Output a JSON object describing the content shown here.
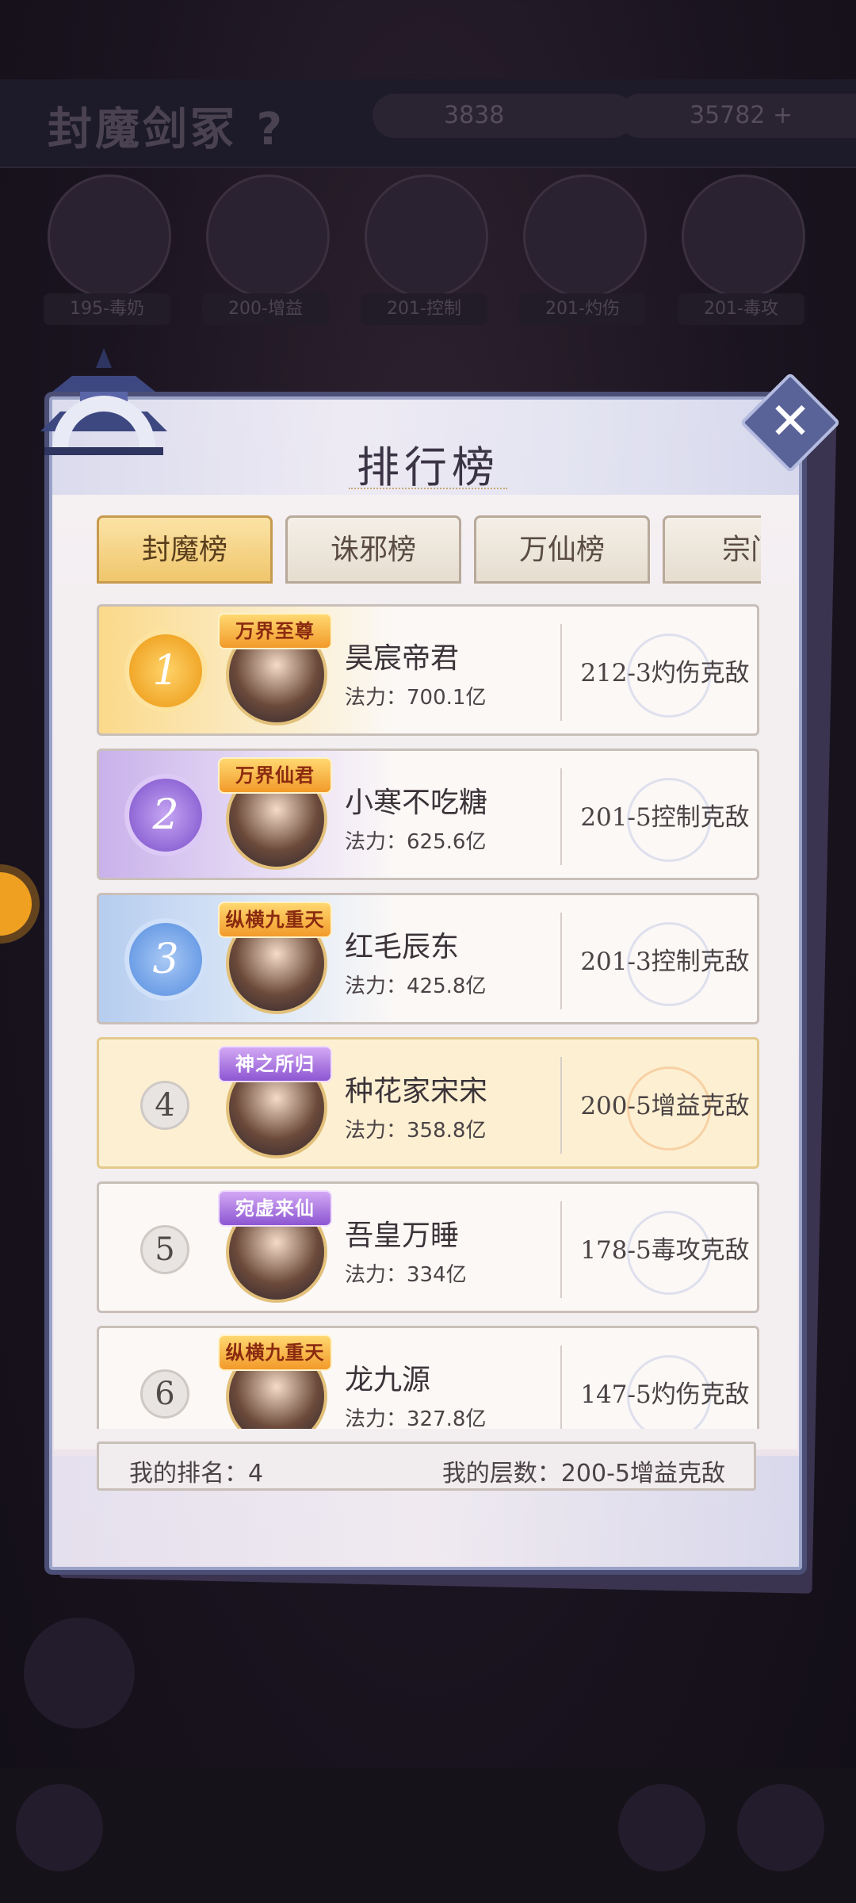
{
  "background": {
    "title": "封魔剑冢 ?",
    "resource_1": "3838",
    "resource_2": "35782 +",
    "heroes": [
      "195-毒奶",
      "200-增益",
      "201-控制",
      "201-灼伤",
      "201-毒攻"
    ]
  },
  "panel": {
    "title": "排行榜",
    "close_icon": "close-icon"
  },
  "tabs": [
    {
      "label": "封魔榜",
      "active": true
    },
    {
      "label": "诛邪榜",
      "active": false
    },
    {
      "label": "万仙榜",
      "active": false
    },
    {
      "label": "宗门",
      "active": false
    }
  ],
  "ranking": [
    {
      "rank": "1",
      "badge": "万界至尊",
      "name": "昊宸帝君",
      "power": "法力：700.1亿",
      "floor": "212-3灼伤克敌",
      "style": "gold"
    },
    {
      "rank": "2",
      "badge": "万界仙君",
      "name": "小寒不吃糖",
      "power": "法力：625.6亿",
      "floor": "201-5控制克敌",
      "style": "purple"
    },
    {
      "rank": "3",
      "badge": "纵横九重天",
      "name": "红毛辰东",
      "power": "法力：425.8亿",
      "floor": "201-3控制克敌",
      "style": "blue"
    },
    {
      "rank": "4",
      "badge": "神之所归",
      "name": "种花家宋宋",
      "power": "法力：358.8亿",
      "floor": "200-5增益克敌",
      "style": "mine"
    },
    {
      "rank": "5",
      "badge": "宛虚来仙",
      "name": "吾皇万睡",
      "power": "法力：334亿",
      "floor": "178-5毒攻克敌",
      "style": "plain"
    },
    {
      "rank": "6",
      "badge": "纵横九重天",
      "name": "龙九源",
      "power": "法力：327.8亿",
      "floor": "147-5灼伤克敌",
      "style": "plain"
    }
  ],
  "my_info": {
    "rank_label": "我的排名：4",
    "floor_label": "我的层数：200-5增益克敌"
  }
}
